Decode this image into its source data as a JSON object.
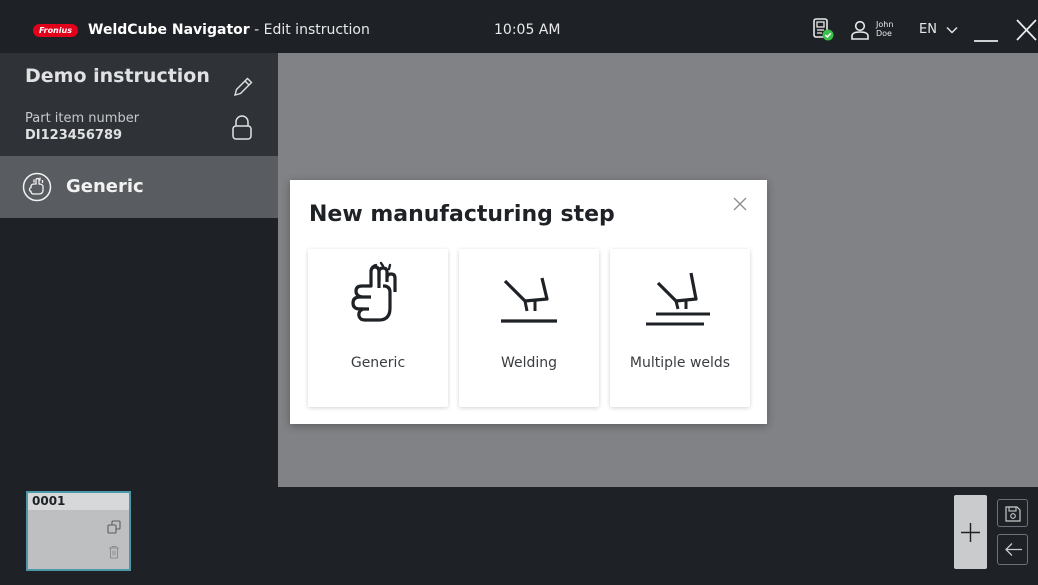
{
  "header": {
    "logo_text": "Fronius",
    "app_name": "WeldCube Navigator",
    "title_suffix": " - Edit instruction",
    "time": "10:05 AM",
    "user_first": "John",
    "user_last": "Doe",
    "language": "EN"
  },
  "sidebar": {
    "instruction_title": "Demo instruction",
    "part_label": "Part item number",
    "part_value": "DI123456789",
    "step_label": "Generic"
  },
  "steps_strip": {
    "thumbnails": [
      {
        "number": "0001"
      }
    ]
  },
  "modal": {
    "title": "New manufacturing step",
    "options": [
      {
        "label": "Generic",
        "icon": "hand-icon"
      },
      {
        "label": "Welding",
        "icon": "welding-torch-icon"
      },
      {
        "label": "Multiple welds",
        "icon": "multiple-welds-icon"
      }
    ]
  },
  "colors": {
    "brand": "#e2001a",
    "topbar": "#1e2125",
    "workspace": "#808285",
    "selected_step": "#595d61",
    "device_status": "#3bbf4b",
    "thumbnail_border": "#4d97a9"
  }
}
